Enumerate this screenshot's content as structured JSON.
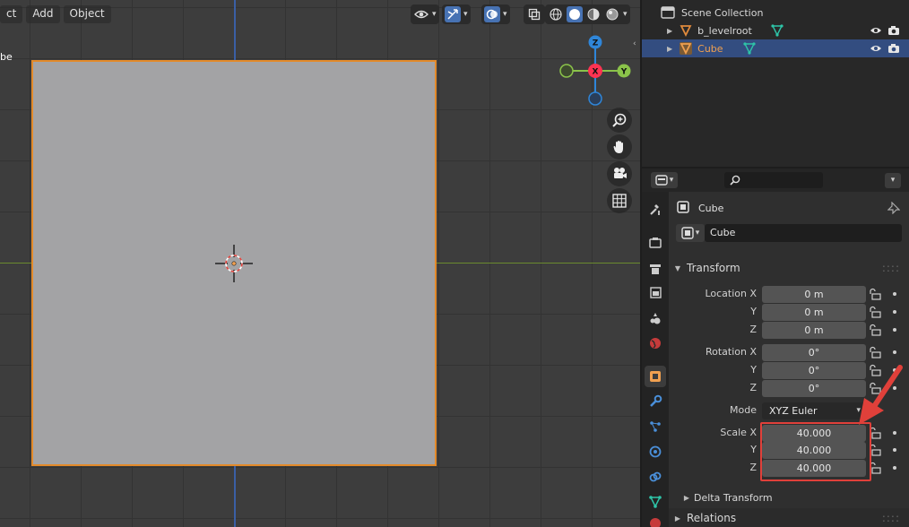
{
  "viewport": {
    "menu": [
      "ct",
      "Add",
      "Object"
    ],
    "overlay_label": "be"
  },
  "outliner": {
    "root": "Scene Collection",
    "items": [
      {
        "label": "b_levelroot",
        "selected": false
      },
      {
        "label": "Cube",
        "selected": true
      }
    ]
  },
  "properties": {
    "object_name": "Cube",
    "object_name_field": "Cube",
    "search_placeholder": "",
    "transform": {
      "title": "Transform",
      "location": {
        "label_x": "Location X",
        "x": "0 m",
        "y": "0 m",
        "z": "0 m"
      },
      "rotation": {
        "label_x": "Rotation X",
        "x": "0°",
        "y": "0°",
        "z": "0°"
      },
      "mode": {
        "label": "Mode",
        "value": "XYZ Euler"
      },
      "scale": {
        "label_x": "Scale X",
        "x": "40.000",
        "y": "40.000",
        "z": "40.000"
      },
      "axis_y": "Y",
      "axis_z": "Z"
    },
    "delta_transform": "Delta Transform",
    "relations": "Relations"
  },
  "gizmo": {
    "x": "X",
    "y": "Y",
    "z": "Z"
  },
  "colors": {
    "accent": "#4772b3",
    "selection_outline": "#e38a2a",
    "highlight_box": "#e0403a",
    "x_axis": "#ff3352",
    "y_axis": "#8bc34a",
    "z_axis": "#2f86d9"
  }
}
